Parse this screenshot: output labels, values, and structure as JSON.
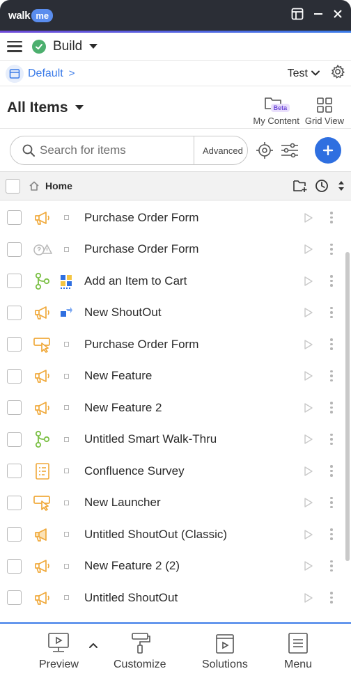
{
  "titlebar": {
    "brand_walk": "walk",
    "brand_me": "me"
  },
  "buildbar": {
    "label": "Build"
  },
  "env": {
    "name": "Default",
    "chevron": ">",
    "target": "Test"
  },
  "items_header": {
    "title": "All Items",
    "my_content_label": "My Content",
    "beta_badge": "Beta",
    "grid_view_label": "Grid View"
  },
  "search": {
    "placeholder": "Search for items",
    "advanced_label": "Advanced"
  },
  "table_header": {
    "home_label": "Home"
  },
  "items": [
    {
      "name": "Purchase Order Form",
      "type_icon": "megaphone-icon"
    },
    {
      "name": "Purchase Order Form",
      "type_icon": "help-disabled-icon"
    },
    {
      "name": "Add an Item to Cart",
      "type_icon": "walkthru-icon"
    },
    {
      "name": "New ShoutOut",
      "type_icon": "megaphone-icon"
    },
    {
      "name": "Purchase Order Form",
      "type_icon": "launcher-icon"
    },
    {
      "name": "New Feature",
      "type_icon": "megaphone-icon"
    },
    {
      "name": "New Feature 2",
      "type_icon": "megaphone-icon"
    },
    {
      "name": "Untitled Smart Walk-Thru",
      "type_icon": "walkthru-icon"
    },
    {
      "name": "Confluence Survey",
      "type_icon": "survey-icon"
    },
    {
      "name": "New Launcher",
      "type_icon": "launcher-icon"
    },
    {
      "name": "Untitled ShoutOut (Classic)",
      "type_icon": "megaphone-classic-icon"
    },
    {
      "name": "New Feature 2 (2)",
      "type_icon": "megaphone-icon"
    },
    {
      "name": "Untitled ShoutOut",
      "type_icon": "megaphone-icon"
    }
  ],
  "bottom_nav": {
    "preview": "Preview",
    "customize": "Customize",
    "solutions": "Solutions",
    "menu": "Menu"
  },
  "colors": {
    "titlebar_bg": "#2b2e36",
    "accent_blue": "#3b7be8",
    "accent_purple": "#6e49d8",
    "build_green": "#4caf6e",
    "megaphone_orange": "#f0a93b",
    "walkthru_green": "#7cc046"
  }
}
